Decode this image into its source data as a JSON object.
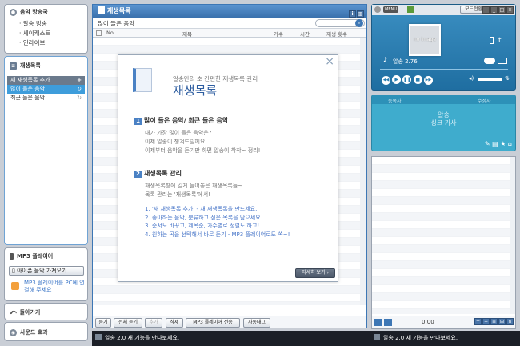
{
  "left": {
    "broadcast": {
      "title": "음악 방송국",
      "items": [
        "알송 방송",
        "세이캐스트",
        "인라이브"
      ]
    },
    "playlist": {
      "title": "재생목록",
      "new_label": "새 재생목록 추가",
      "items": [
        "많이 들은 음악",
        "최근 들은 음악"
      ]
    },
    "mp3": {
      "title": "MP3 플레이어",
      "iphone_button": "아이폰 음악 가져오기",
      "connect_msg": "MP3 플레이어를 PC에 연결해 주세요"
    },
    "rewind": {
      "title": "돌아가기"
    },
    "sound": {
      "title": "사운드 효과"
    }
  },
  "main": {
    "title": "재생목록",
    "list_name": "많이 들은 음악",
    "search_placeholder": "",
    "columns": [
      "No.",
      "제목",
      "가수",
      "시간",
      "재생 횟수"
    ],
    "bottom_buttons": [
      "듣기",
      "전체 듣기",
      "추가",
      "삭제",
      "MP3 플레이어 전송",
      "자동태그"
    ]
  },
  "dialog": {
    "subtitle": "알송만의 초 간편한 재생목록 관리",
    "title": "재생목록",
    "section1": {
      "num": "1",
      "heading": "많이 들은 음악/ 최근 들은 음악",
      "lines": [
        "내가 가장 많이 들은 음악은?",
        "이제 알송이 챙겨드릴께요.",
        "이제부터 음악을 듣기만 하면 알송이 착착~ 정리!"
      ]
    },
    "section2": {
      "num": "2",
      "heading": "재생목록 관리",
      "lines": [
        "재생목록창에 길게 늘어놓은 재생목록들~",
        "목록 관리는 '재생목록'에서!"
      ],
      "steps": [
        "1. '새 재생목록 추가' - 새 재생목록을 만드세요.",
        "2. 좋아하는 음악, 분류하고 싶은 목록을 담으세요.",
        "3. 순서도 바꾸고, 제목순, 가수별로 정렬도 하고!",
        "4. 원하는 곡을 선택해서 바로 듣기 - MP3 플레이어로도 쏙~!"
      ]
    },
    "more_button": "자세히 보기 ›"
  },
  "player": {
    "menu": "MENU",
    "mode_button": "모드전환",
    "noimage": "no image",
    "version": "알송 2.76",
    "lyrics_left": "동목자",
    "lyrics_right": "수정자",
    "lyrics_line1": "알송",
    "lyrics_line2": "싱크 가사",
    "time": "0:00"
  },
  "status": {
    "ticker": "알송 2.0 새 기능을 만나보세요."
  },
  "colors": {
    "accent": "#2b8fb8",
    "header": "#3d77b5",
    "dialog_title": "#2d5da0",
    "link": "#4a77c9"
  }
}
